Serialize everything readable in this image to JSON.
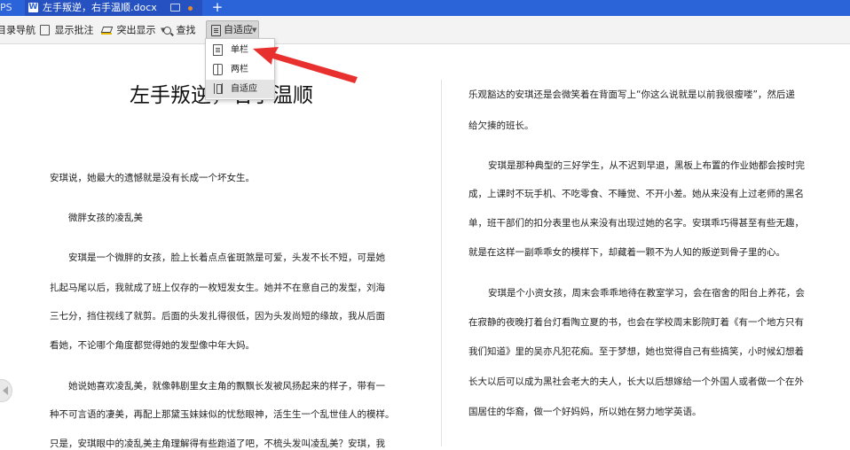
{
  "tabbar": {
    "left_label": "PS",
    "doc_tab_title": "左手叛逆，右手温顺.docx",
    "doc_icon_letter": "W",
    "new_tab_label": "+"
  },
  "toolbar": {
    "toc_nav": "目录导航",
    "show_comments": "显示批注",
    "highlight": "突出显示",
    "find": "查找",
    "adapt": "自适应"
  },
  "dropdown": {
    "items": [
      {
        "label": "单栏",
        "icon": "single-column-icon"
      },
      {
        "label": "两栏",
        "icon": "two-column-icon"
      },
      {
        "label": "自适应",
        "icon": "adaptive-icon",
        "selected": true
      }
    ]
  },
  "document": {
    "title": "左手叛逆，右手温顺",
    "left": [
      "安琪说，她最大的遗憾就是没有长成一个坏女生。",
      "微胖女孩的凌乱美",
      "安琪是一个微胖的女孩，脸上长着点点雀斑煞是可爱，头发不长不短，可是她",
      "扎起马尾以后，我就成了班上仅存的一枚短发女生。她并不在意自己的发型，刘海",
      "三七分，挡住视线了就剪。后面的头发扎得很低，因为头发尚短的缘故，我从后面",
      "看她，不论哪个角度都觉得她的发型像中年大妈。",
      "她说她喜欢凌乱美，就像韩剧里女主角的飘飘长发被风扬起来的样子，带有一",
      "种不可言语的凄美，再配上那黛玉妹妹似的忧愁眼神，活生生一个乱世佳人的模样。",
      "只是，安琪眼中的凌乱美主角理解得有些跑道了吧，不梳头发叫凌乱美？安琪，我"
    ],
    "right": [
      "乐观豁达的安琪还是会微笑着在背面写上“你这么说就是以前我很瘦喽”，然后递",
      "给欠揍的班长。",
      "安琪是那种典型的三好学生，从不迟到早退，黑板上布置的作业她都会按时完",
      "成，上课时不玩手机、不吃零食、不睡觉、不开小差。她从来没有上过老师的黑名",
      "单，班干部们的扣分表里也从来没有出现过她的名字。安琪乖巧得甚至有些无趣，",
      "就是在这样一副乖乖女的模样下，却藏着一颗不为人知的叛逆到骨子里的心。",
      "安琪是个小资女孩，周末会乖乖地待在教室学习，会在宿舍的阳台上养花，会",
      "在寂静的夜晚打着台灯看陶立夏的书，也会在学校周末影院盯着《有一个地方只有",
      "我们知道》里的吴亦凡犯花痴。至于梦想，她也觉得自己有些搞笑，小时候幻想着",
      "长大以后可以成为黑社会老大的夫人，长大以后想嫁给一个外国人或者做一个在外",
      "国居住的华裔，做一个好妈妈，所以她在努力地学英语。"
    ]
  },
  "colors": {
    "tabbar": "#2b63d8",
    "active_tab": "#2552c0",
    "arrow": "#e8312f",
    "toolbar": "#f3f3f3"
  }
}
